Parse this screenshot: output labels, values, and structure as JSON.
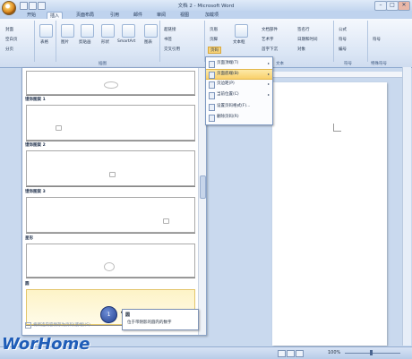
{
  "window": {
    "title": "文档 2 - Microsoft Word",
    "controls": [
      "–",
      "□",
      "✕"
    ]
  },
  "tabs": [
    "开始",
    "插入",
    "页面布局",
    "引用",
    "邮件",
    "审阅",
    "视图",
    "加载项"
  ],
  "ribbon": {
    "pages_group": {
      "items": [
        "封面",
        "空白页",
        "分页"
      ]
    },
    "table_label": "表格",
    "illustrations": {
      "label": "插图",
      "items": [
        "图片",
        "剪贴画",
        "形状",
        "SmartArt",
        "图表"
      ]
    },
    "links": {
      "items": [
        "超链接",
        "书签",
        "交叉引用"
      ]
    },
    "header_footer": {
      "items": [
        "页眉",
        "页脚",
        "页码"
      ]
    },
    "text_group": {
      "label": "文本",
      "items": [
        "文本框",
        "文档部件",
        "艺术字",
        "首字下沉",
        "签名行",
        "日期和时间",
        "对象"
      ]
    },
    "symbols_group": {
      "label": "符号",
      "items": [
        "公式",
        "符号",
        "编号"
      ]
    },
    "special_group": {
      "label": "特殊符号",
      "items": [
        "符号"
      ]
    }
  },
  "page_number_menu": {
    "items": [
      {
        "label": "页面顶端(T)",
        "arrow": "▸"
      },
      {
        "label": "页面底端(B)",
        "arrow": "▸"
      },
      {
        "label": "页边距(P)",
        "arrow": "▸"
      },
      {
        "label": "当前位置(C)",
        "arrow": "▸"
      },
      {
        "label": "设置页码格式(F)...",
        "arrow": ""
      },
      {
        "label": "删除页码(R)",
        "arrow": ""
      }
    ]
  },
  "gallery": {
    "sections": [
      "馒饰图案 1",
      "馒饰图案 2",
      "馒饰图案 3",
      "星形",
      "圆"
    ],
    "footer": "将所选内容保存为页码(底端)(S)"
  },
  "tooltip": {
    "title": "圆",
    "text": "位于带阴影的圆内的数字"
  },
  "statusbar": {
    "zoom": "100%"
  },
  "watermark": "WorHome"
}
